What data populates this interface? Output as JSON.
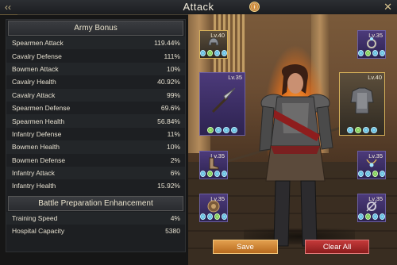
{
  "header": {
    "title": "Attack",
    "info_symbol": "ⓘ",
    "back_symbol": "‹‹",
    "close_symbol": "✕"
  },
  "army_bonus": {
    "title": "Army Bonus",
    "rows": [
      {
        "name": "Spearmen Attack",
        "value": "119.44%"
      },
      {
        "name": "Cavalry Defense",
        "value": "111%"
      },
      {
        "name": "Bowmen Attack",
        "value": "10%"
      },
      {
        "name": "Cavalry Health",
        "value": "40.92%"
      },
      {
        "name": "Cavalry Attack",
        "value": "99%"
      },
      {
        "name": "Spearmen Defense",
        "value": "69.6%"
      },
      {
        "name": "Spearmen Health",
        "value": "56.84%"
      },
      {
        "name": "Infantry Defense",
        "value": "11%"
      },
      {
        "name": "Bowmen Health",
        "value": "10%"
      },
      {
        "name": "Bowmen Defense",
        "value": "2%"
      },
      {
        "name": "Infantry Attack",
        "value": "6%"
      },
      {
        "name": "Infantry Health",
        "value": "15.92%"
      }
    ]
  },
  "battle_prep": {
    "title": "Battle Preparation Enhancement",
    "rows": [
      {
        "name": "Training Speed",
        "value": "4%"
      },
      {
        "name": "Hospital Capacity",
        "value": "5380"
      }
    ]
  },
  "equipment": {
    "helmet": {
      "level": "Lv.40",
      "icon": "helmet-icon"
    },
    "weapon": {
      "level": "Lv.35",
      "icon": "spear-icon"
    },
    "boots": {
      "level": "Lv.35",
      "icon": "boots-icon"
    },
    "shield": {
      "level": "Lv.35",
      "icon": "shield-icon"
    },
    "accessory_top": {
      "level": "Lv.35",
      "icon": "ring-icon"
    },
    "armor": {
      "level": "Lv.40",
      "icon": "armor-icon"
    },
    "necklace": {
      "level": "Lv.35",
      "icon": "necklace-icon"
    },
    "amulet": {
      "level": "Lv.35",
      "icon": "amulet-icon"
    }
  },
  "actions": {
    "save_label": "Save",
    "clear_label": "Clear All"
  },
  "colors": {
    "accent_gold": "#d6b15a",
    "save_button": "#e3a04e",
    "clear_button": "#c53a3a",
    "slot_purple": "#4c3a7a"
  }
}
